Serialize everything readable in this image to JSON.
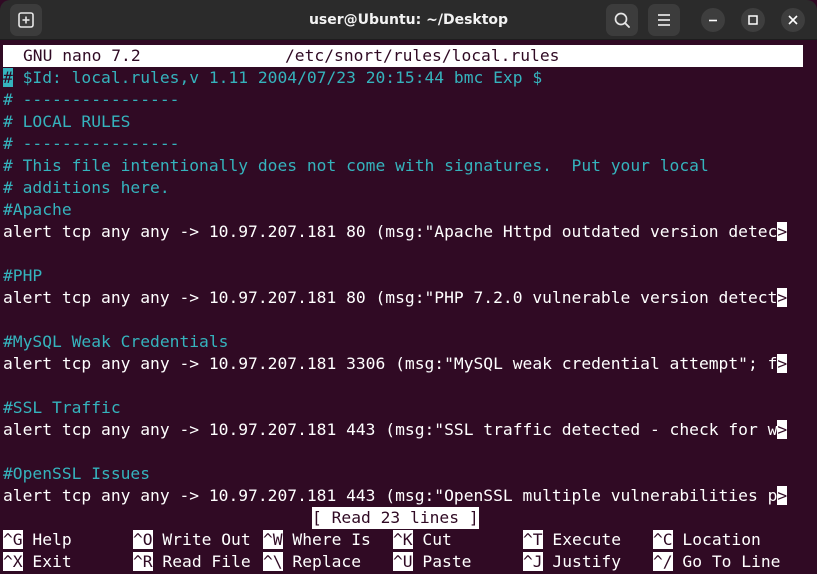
{
  "window": {
    "title": "user@Ubuntu: ~/Desktop"
  },
  "nano": {
    "version": "GNU nano 7.2",
    "filename": "/etc/snort/rules/local.rules",
    "status": "[ Read 23 lines ]"
  },
  "lines": {
    "l0": " $Id: local.rules,v 1.11 2004/07/23 20:15:44 bmc Exp $",
    "l1": "# ----------------",
    "l2": "# LOCAL RULES",
    "l3": "# ----------------",
    "l4": "# This file intentionally does not come with signatures.  Put your local",
    "l5": "# additions here.",
    "l6": "#Apache",
    "l7": "alert tcp any any -> 10.97.207.181 80 (msg:\"Apache Httpd outdated version detec",
    "l9": "#PHP",
    "l10": "alert tcp any any -> 10.97.207.181 80 (msg:\"PHP 7.2.0 vulnerable version detect",
    "l12": "#MySQL Weak Credentials",
    "l13": "alert tcp any any -> 10.97.207.181 3306 (msg:\"MySQL weak credential attempt\"; f",
    "l15": "#SSL Traffic",
    "l16": "alert tcp any any -> 10.97.207.181 443 (msg:\"SSL traffic detected - check for w",
    "l18": "#OpenSSL Issues",
    "l19": "alert tcp any any -> 10.97.207.181 443 (msg:\"OpenSSL multiple vulnerabilities p"
  },
  "cursor_char": "#",
  "truncation_marker": ">",
  "shortcuts": {
    "help": {
      "key": "^G",
      "label": " Help"
    },
    "writeout": {
      "key": "^O",
      "label": " Write Out"
    },
    "whereis": {
      "key": "^W",
      "label": " Where Is"
    },
    "cut": {
      "key": "^K",
      "label": " Cut"
    },
    "execute": {
      "key": "^T",
      "label": " Execute"
    },
    "location": {
      "key": "^C",
      "label": " Location"
    },
    "exit": {
      "key": "^X",
      "label": " Exit"
    },
    "readfile": {
      "key": "^R",
      "label": " Read File"
    },
    "replace": {
      "key": "^\\",
      "label": " Replace"
    },
    "paste": {
      "key": "^U",
      "label": " Paste"
    },
    "justify": {
      "key": "^J",
      "label": " Justify"
    },
    "gotoline": {
      "key": "^/",
      "label": " Go To Line"
    }
  },
  "colors": {
    "background": "#300a24",
    "comment": "#35b3bd",
    "titlebar": "#2b2b2b"
  }
}
